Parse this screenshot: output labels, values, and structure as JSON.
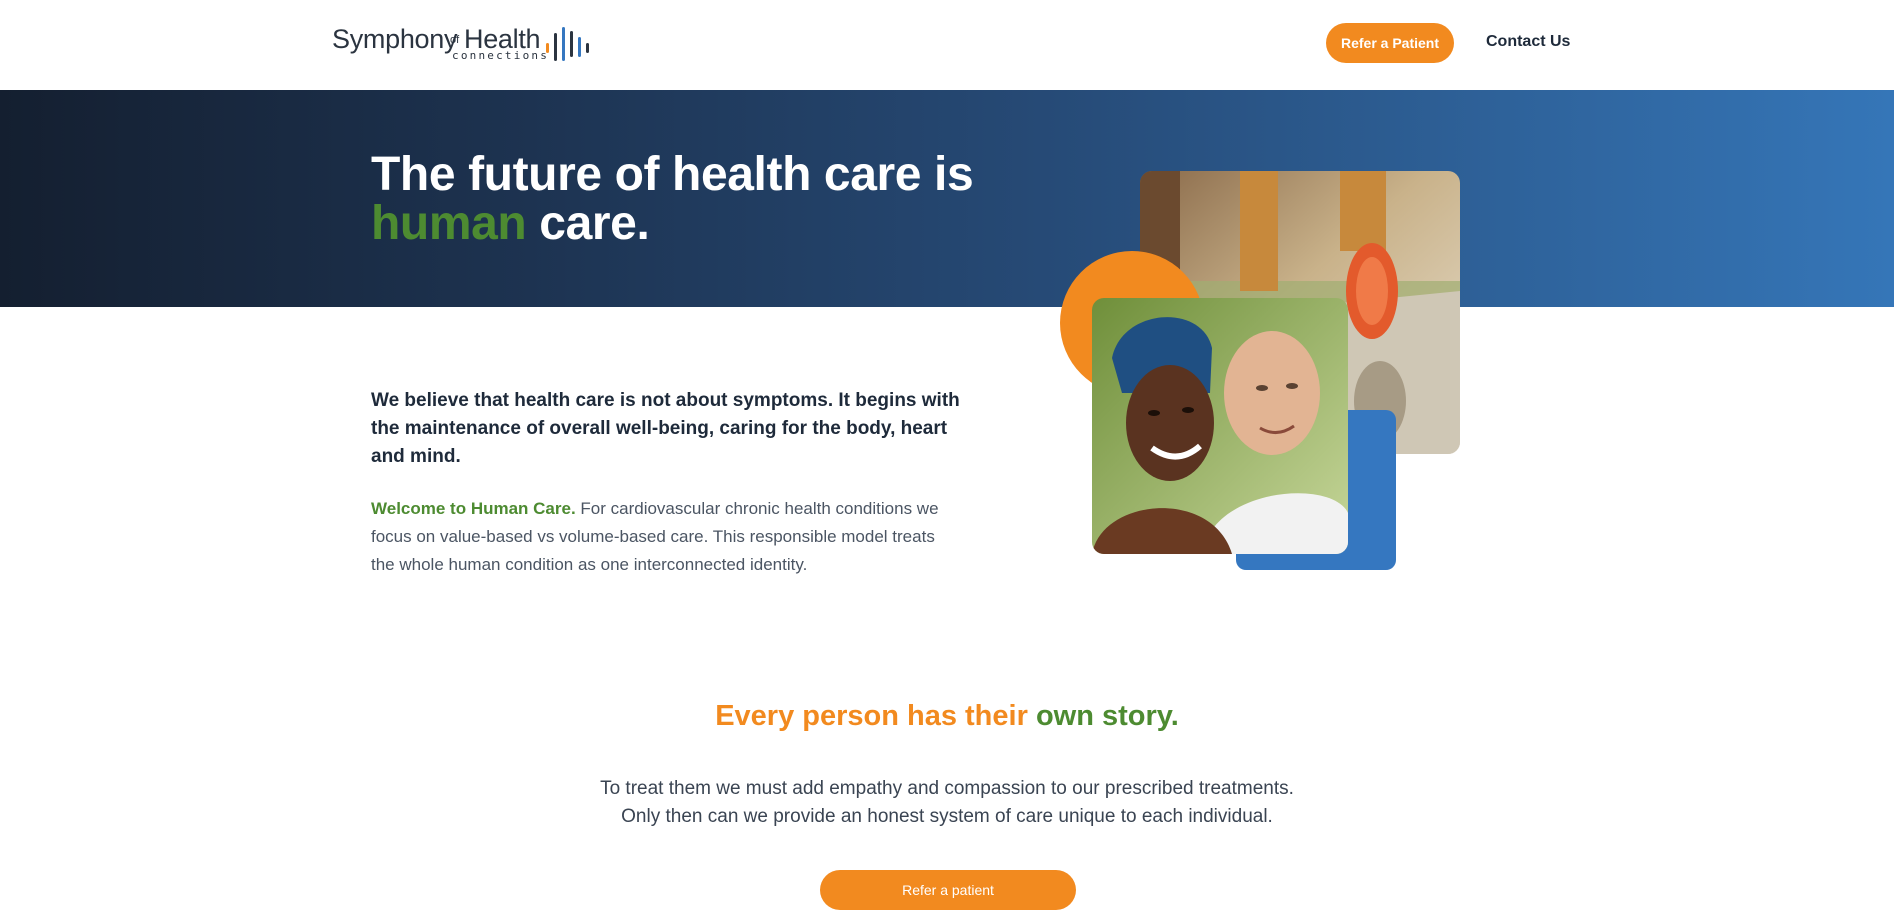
{
  "header": {
    "logo": {
      "word1": "Symphony",
      "of": "of",
      "word2": "Health",
      "sub": "connections"
    },
    "refer_button": "Refer a Patient",
    "contact_link": "Contact Us"
  },
  "hero": {
    "title_line1": "The future of health care is",
    "title_green": "human",
    "title_end": " care."
  },
  "intro": {
    "lead": "We believe that health care is not about symptoms. It begins with the maintenance of overall well-being, caring for the body, heart and mind.",
    "welcome": "Welcome to Human Care.",
    "body": " For cardiovascular chronic health conditions we focus on value-based vs volume-based care. This responsible model treats the whole human condition as one interconnected identity."
  },
  "story": {
    "title_orange": "Every person has their ",
    "title_green": "own story.",
    "line1": "To treat them we must add empathy and compassion to our prescribed treatments.",
    "line2": "Only then can we provide an honest system of care unique to each individual.",
    "button": "Refer a patient"
  },
  "colors": {
    "brand_orange": "#f28a1f",
    "brand_green": "#4d8b31",
    "brand_blue": "#3577c0",
    "navy": "#141f30"
  }
}
